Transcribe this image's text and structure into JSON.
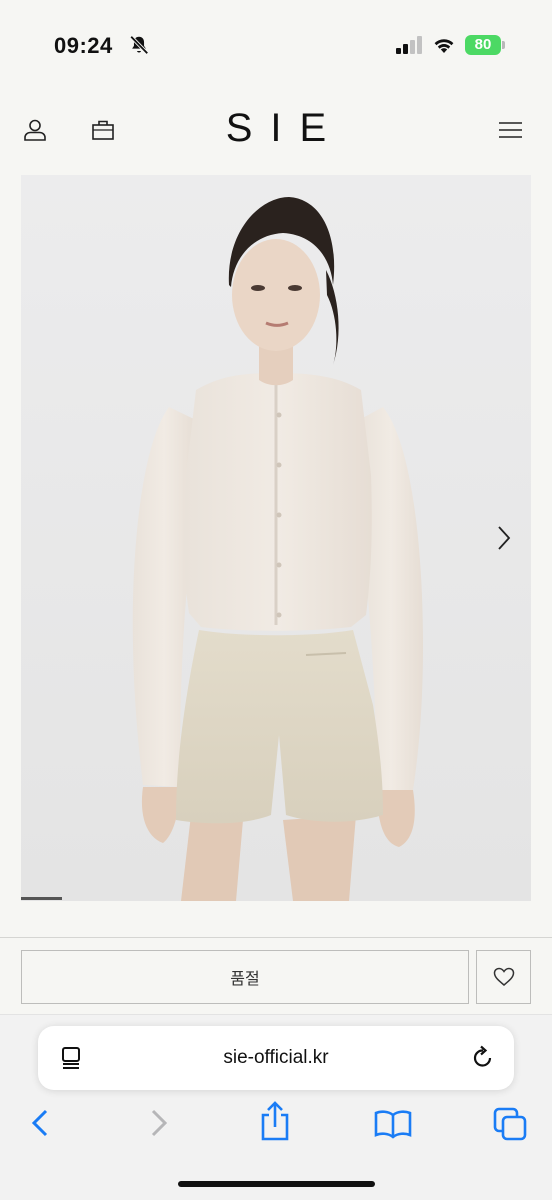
{
  "status_bar": {
    "time": "09:24",
    "battery": "80"
  },
  "header": {
    "logo": "SIE"
  },
  "gallery": {
    "slide_progress": 0.08
  },
  "product": {
    "soldout_label": "품절"
  },
  "browser": {
    "url": "sie-official.kr"
  },
  "colors": {
    "accent_blue": "#1a7cf5",
    "battery_green": "#4cd964"
  },
  "icons": [
    "bell-off-icon",
    "signal-icon",
    "wifi-icon",
    "battery-icon",
    "user-icon",
    "bag-icon",
    "menu-icon",
    "chevron-right-icon",
    "heart-icon",
    "reader-icon",
    "reload-icon",
    "back-icon",
    "forward-icon",
    "share-icon",
    "bookmarks-icon",
    "tabs-icon"
  ]
}
